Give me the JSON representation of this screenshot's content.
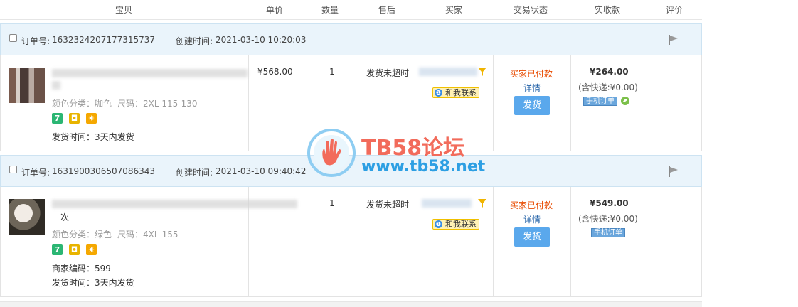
{
  "header": {
    "columns": [
      "宝贝",
      "单价",
      "数量",
      "售后",
      "买家",
      "交易状态",
      "实收款",
      "评价"
    ]
  },
  "orders": [
    {
      "order_label": "订单号:",
      "order_no": "1632324207177315737",
      "created_label": "创建时间:",
      "created_time": "2021-03-10 10:20:03",
      "sku_color": "颜色分类：咖色",
      "sku_size": "尺码：2XL 115-130",
      "merchant_code": "",
      "ship_time": "发货时间：3天内发货",
      "unit_price": "¥568.00",
      "quantity": "1",
      "after_sale": "发货未超时",
      "contact": "和我联系",
      "status": "买家已付款",
      "detail": "详情",
      "ship_button": "发货",
      "amount": "¥264.00",
      "shipping_fee": "(含快递:¥0.00)",
      "mobile_tag": "手机订单"
    },
    {
      "order_label": "订单号:",
      "order_no": "1631900306507086343",
      "created_label": "创建时间:",
      "created_time": "2021-03-10 09:40:42",
      "title_tail": "次",
      "sku_color": "颜色分类：绿色",
      "sku_size": "尺码：4XL-155",
      "merchant_code": "商家编码：599",
      "ship_time": "发货时间：3天内发货",
      "unit_price": "",
      "quantity": "1",
      "after_sale": "发货未超时",
      "contact": "和我联系",
      "status": "买家已付款",
      "detail": "详情",
      "ship_button": "发货",
      "amount": "¥549.00",
      "shipping_fee": "(含快递:¥0.00)",
      "mobile_tag": "手机订单"
    }
  ],
  "watermark": {
    "brand": "TB58论坛",
    "url": "www.tb58.net"
  },
  "colors": {
    "status": "#e84b00",
    "ship_button": "#5aa8ec",
    "order_header_bg": "#eaf4fb",
    "watermark_red": "#f26b5b",
    "watermark_blue": "#2d9fe3"
  }
}
